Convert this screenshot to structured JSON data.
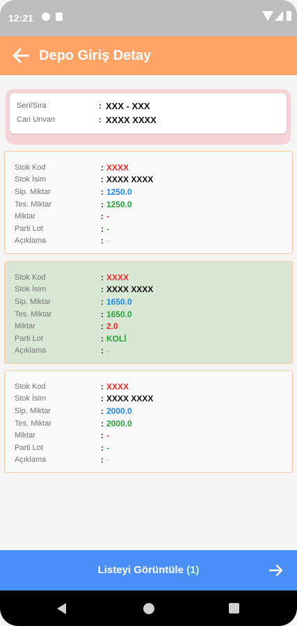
{
  "status": {
    "time": "12:21"
  },
  "app_bar": {
    "title": "Depo Giriş Detay"
  },
  "header": {
    "rows": [
      {
        "label": "Seri/Sıra",
        "value": "XXX - XXX"
      },
      {
        "label": "Cari Unvan",
        "value": "XXXX XXXX"
      }
    ]
  },
  "labels": {
    "stok_kod": "Stok Kod",
    "stok_isim": "Stok İsim",
    "sip_miktar": "Sip. Miktar",
    "tes_miktar": "Tes. Miktar",
    "miktar": "Miktar",
    "parti_lot": "Parti Lot",
    "aciklama": "Açıklama",
    "colon": ":"
  },
  "items": [
    {
      "stok_kod": "XXXX",
      "stok_isim": "XXXX XXXX",
      "sip_miktar": "1250.0",
      "tes_miktar": "1250.0",
      "miktar": "-",
      "parti_lot": "-",
      "aciklama": "-"
    },
    {
      "stok_kod": "XXXX",
      "stok_isim": "XXXX XXXX",
      "sip_miktar": "1650.0",
      "tes_miktar": "1650.0",
      "miktar": "2.0",
      "parti_lot": "KOLİ",
      "aciklama": "-"
    },
    {
      "stok_kod": "XXXX",
      "stok_isim": "XXXX XXXX",
      "sip_miktar": "2000.0",
      "tes_miktar": "2000.0",
      "miktar": "-",
      "parti_lot": "-",
      "aciklama": "-"
    }
  ],
  "bottom_button": {
    "label": "Listeyi Görüntüle",
    "count": "(1)"
  },
  "colors": {
    "app_bar": "#ffa366",
    "button": "#4a8ff7",
    "highlight_card": "#d9e8d5",
    "red_value": "#ee2b2b",
    "blue_value": "#1e88e5",
    "green_value": "#26a03b"
  },
  "icons": {
    "back": "arrow-left-icon",
    "forward": "arrow-right-icon"
  }
}
